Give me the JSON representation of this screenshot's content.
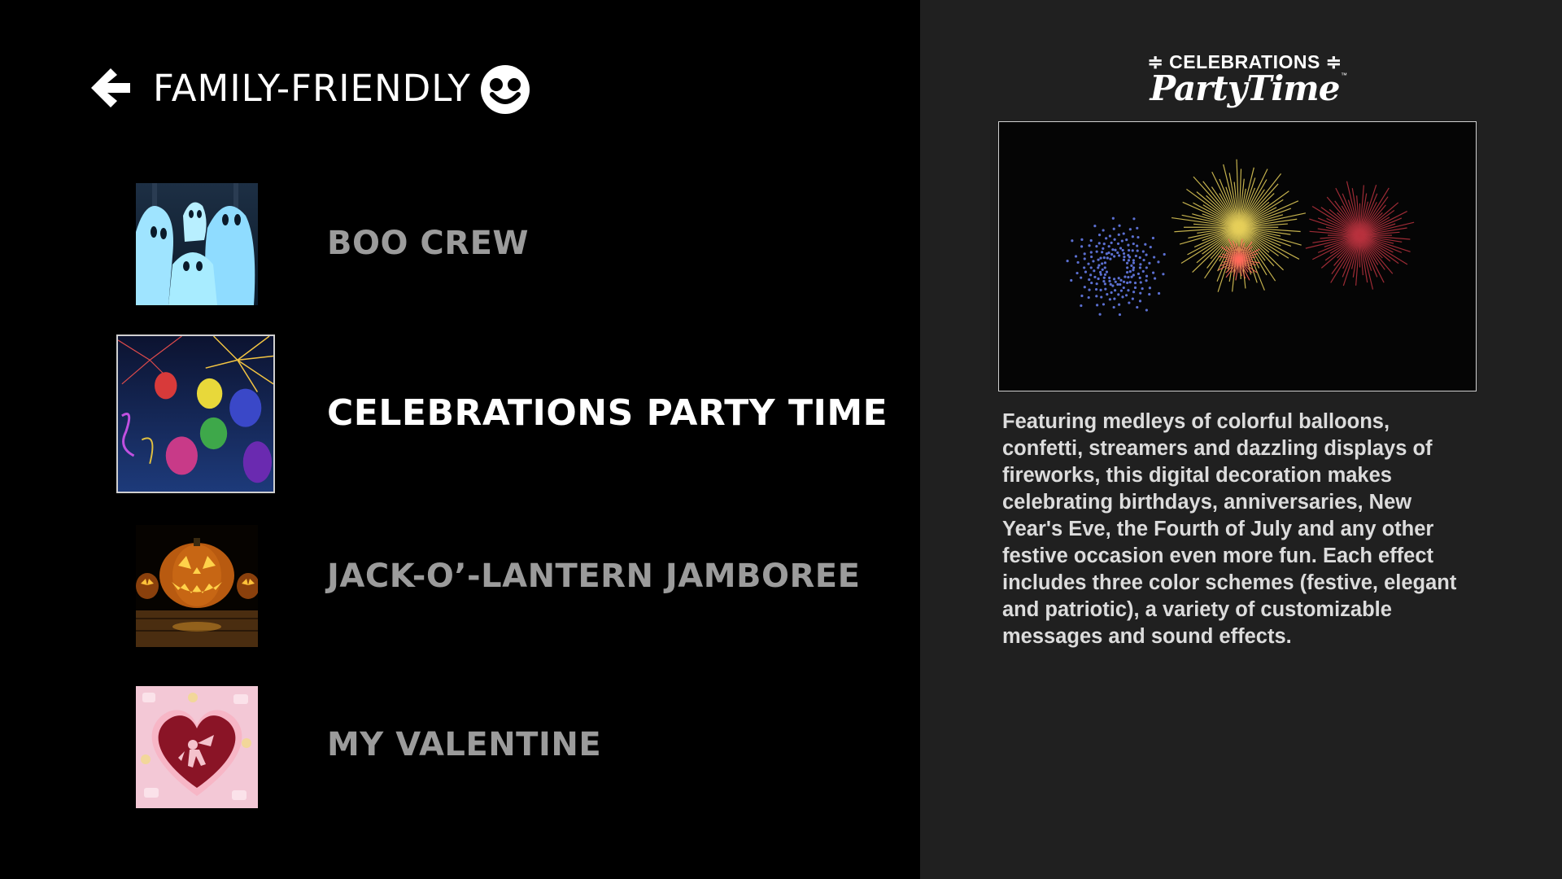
{
  "header": {
    "back_icon": "back-arrow-icon",
    "title": "FAMILY-FRIENDLY",
    "rating_icon": "smiley-face-icon"
  },
  "list": {
    "items": [
      {
        "label": "BOO CREW",
        "thumbnail": "ghosts-thumbnail",
        "selected": false
      },
      {
        "label": "CELEBRATIONS PARTY TIME",
        "thumbnail": "balloons-fireworks-thumbnail",
        "selected": true
      },
      {
        "label": "JACK-O’-LANTERN JAMBOREE",
        "thumbnail": "jack-o-lantern-thumbnail",
        "selected": false
      },
      {
        "label": "MY VALENTINE",
        "thumbnail": "valentine-heart-thumbnail",
        "selected": false
      }
    ]
  },
  "detail": {
    "logo_line1": "CELEBRATIONS",
    "logo_line2": "PartyTime",
    "logo_tm": "™",
    "preview": "fireworks-preview-image",
    "description": "Featuring medleys of colorful balloons, confetti, streamers and dazzling displays of fireworks, this digital decoration makes celebrating birthdays, anniversaries, New Year's Eve, the Fourth of July and any other festive occasion even more fun. Each effect includes three color schemes (festive, elegant and patriotic), a variety of customizable messages and sound effects."
  },
  "colors": {
    "left_background": "#000000",
    "right_background": "#202020",
    "selected_text": "#ffffff",
    "unselected_text": "#9b9b9b",
    "description_text": "#dcdcdc"
  }
}
